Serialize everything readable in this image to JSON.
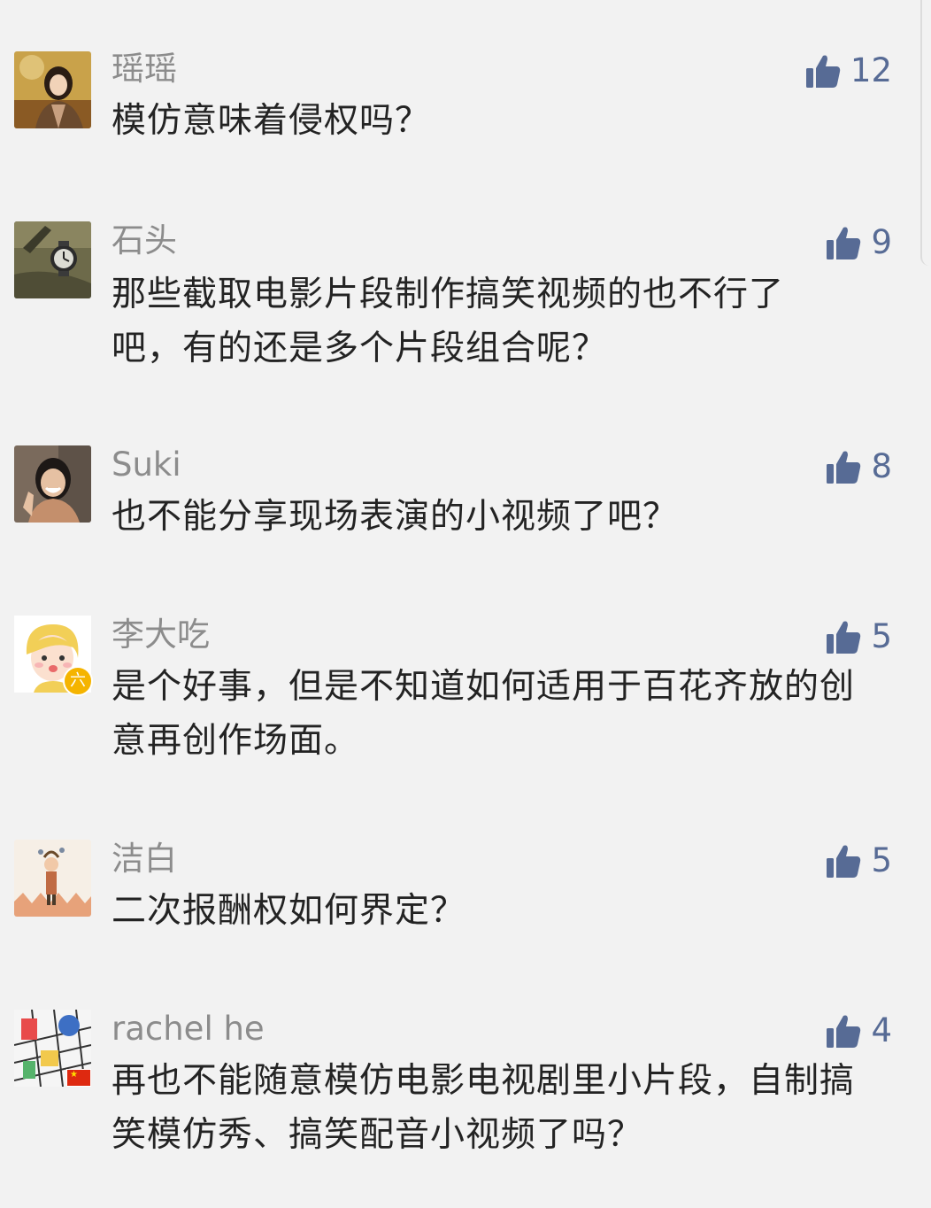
{
  "comments": [
    {
      "username": "瑶瑶",
      "text": "模仿意味着侵权吗？",
      "likes": "12",
      "avatar": "portrait-girl-autumn"
    },
    {
      "username": "石头",
      "text": "那些截取电影片段制作搞笑视频的也不行了吧，有的还是多个片段组合呢？",
      "likes": "9",
      "avatar": "watch-on-canvas"
    },
    {
      "username": "Suki",
      "text": "也不能分享现场表演的小视频了吧？",
      "likes": "8",
      "avatar": "smiling-woman"
    },
    {
      "username": "李大吃",
      "text": "是个好事，但是不知道如何适用于百花齐放的创意再创作场面。",
      "likes": "5",
      "avatar": "cartoon-girl",
      "badge": "六"
    },
    {
      "username": "洁白",
      "text": "二次报酬权如何界定？",
      "likes": "5",
      "avatar": "illustrated-figure"
    },
    {
      "username": "rachel he",
      "text": "再也不能随意模仿电影电视剧里小片段，自制搞笑模仿秀、搞笑配音小视频了吗？",
      "likes": "4",
      "avatar": "colorful-sketch",
      "flag": "china-flag"
    }
  ],
  "colors": {
    "background": "#f2f2f2",
    "username": "#8c8c8c",
    "text": "#232323",
    "like": "#576b95"
  },
  "icons": {
    "like": "thumbs-up-icon"
  }
}
